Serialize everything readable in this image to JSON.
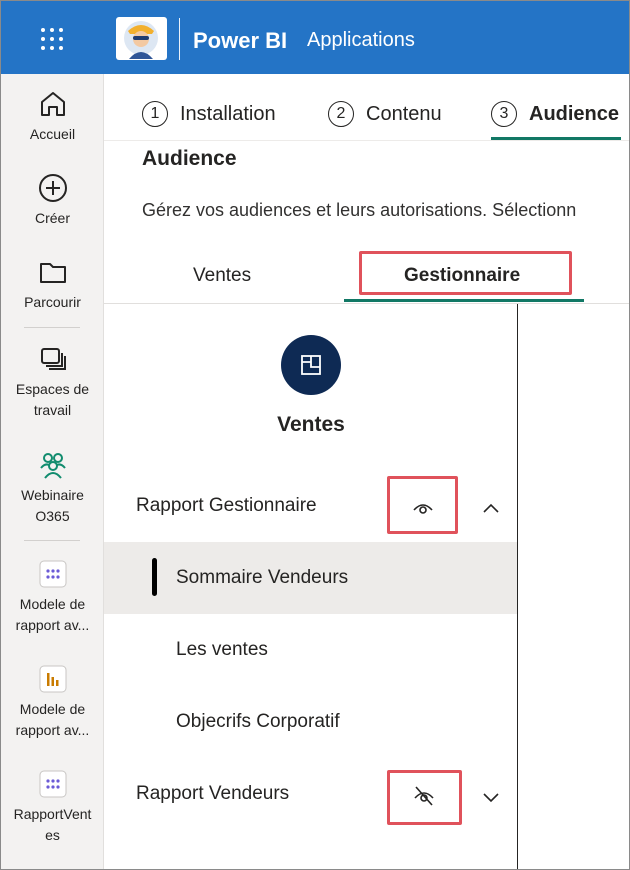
{
  "topbar": {
    "app_name": "Power BI",
    "section": "Applications",
    "brand_color": "#2474c6"
  },
  "nav": {
    "items": [
      {
        "label": "Accueil",
        "icon": "home-icon"
      },
      {
        "label": "Créer",
        "icon": "plus-circle-icon"
      },
      {
        "label": "Parcourir",
        "icon": "folder-icon"
      },
      {
        "label": "Espaces de travail",
        "icon": "workspaces-icon"
      },
      {
        "label": "Webinaire O365",
        "icon": "people-group-icon"
      },
      {
        "label": "Modele de rapport av...",
        "icon": "app-dots-icon"
      },
      {
        "label": "Modele de rapport av...",
        "icon": "bar-chart-icon"
      },
      {
        "label": "RapportVentes",
        "icon": "app-dots-icon"
      }
    ]
  },
  "steps": [
    {
      "number": "1",
      "label": "Installation",
      "active": false
    },
    {
      "number": "2",
      "label": "Contenu",
      "active": false
    },
    {
      "number": "3",
      "label": "Audience",
      "active": true
    }
  ],
  "section": {
    "title": "Audience",
    "description": "Gérez vos audiences et leurs autorisations. Sélectionn"
  },
  "audience_tabs": [
    {
      "label": "Ventes",
      "active": false
    },
    {
      "label": "Gestionnaire",
      "active": true
    }
  ],
  "app": {
    "title": "Ventes"
  },
  "reports": [
    {
      "label": "Rapport Gestionnaire",
      "visibility": "visible",
      "expanded": true,
      "pages": [
        {
          "label": "Sommaire Vendeurs",
          "selected": true
        },
        {
          "label": "Les ventes",
          "selected": false
        },
        {
          "label": "Objecrifs Corporatif",
          "selected": false
        }
      ]
    },
    {
      "label": "Rapport Vendeurs",
      "visibility": "hidden",
      "expanded": false
    }
  ],
  "colors": {
    "accent": "#117865",
    "highlight": "#e0525b",
    "app_icon": "#0e2a54"
  }
}
